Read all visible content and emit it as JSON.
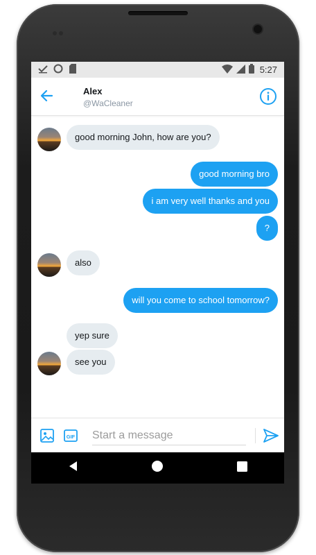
{
  "status_bar": {
    "time": "5:27",
    "left_icons": [
      "check-icon",
      "circle-icon",
      "sim-icon"
    ],
    "right_icons": [
      "wifi-icon",
      "signal-icon",
      "battery-icon"
    ]
  },
  "header": {
    "contact_name": "Alex",
    "contact_handle": "@WaCleaner",
    "back_icon": "back-arrow-icon",
    "info_icon": "info-icon"
  },
  "messages": [
    {
      "sender": "them",
      "text": "good morning John, how are you?"
    },
    {
      "sender": "me",
      "text": "good morning bro"
    },
    {
      "sender": "me",
      "text": "i am very well thanks and you"
    },
    {
      "sender": "me",
      "text": "?"
    },
    {
      "sender": "them",
      "text": "also"
    },
    {
      "sender": "me",
      "text": "will you come to school tomorrow?"
    },
    {
      "sender": "them",
      "text": "yep sure"
    },
    {
      "sender": "them",
      "text": "see you"
    }
  ],
  "compose": {
    "placeholder": "Start a message",
    "value": "",
    "image_icon": "image-icon",
    "gif_label": "GIF",
    "send_icon": "send-icon"
  },
  "navbar": {
    "icons": [
      "back-triangle-icon",
      "home-circle-icon",
      "recents-square-icon"
    ]
  },
  "colors": {
    "accent": "#1da1f2",
    "incoming_bubble": "#e6ecf0",
    "outgoing_bubble": "#1da1f2",
    "status_bar": "#e8e8e8",
    "navbar": "#000000"
  }
}
